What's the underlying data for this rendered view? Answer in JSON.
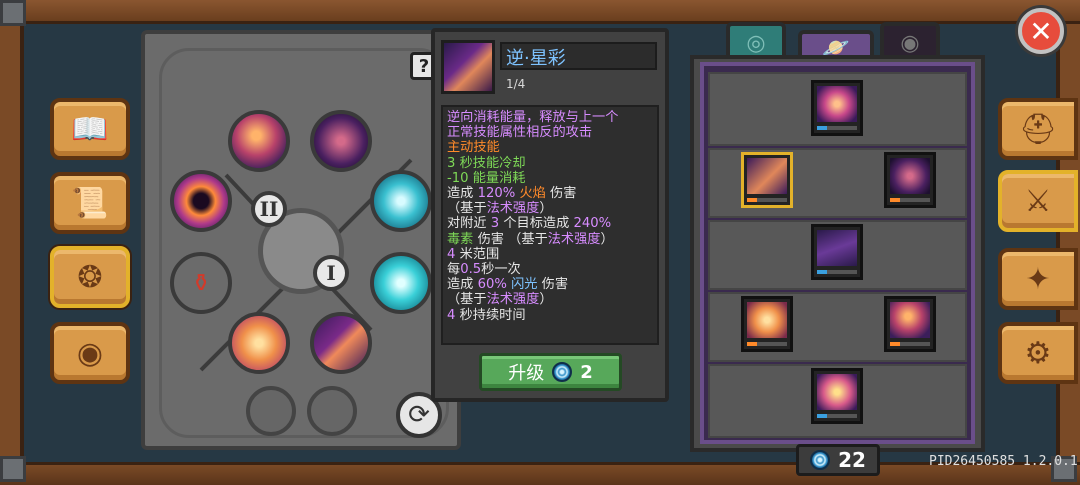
{
  "skill": {
    "name": "逆·星彩",
    "level": "1/4",
    "description": [
      [
        {
          "t": "逆向消耗能量，释放与上一个",
          "c": "p"
        }
      ],
      [
        {
          "t": "正常技能属性相反的攻击",
          "c": "p"
        }
      ],
      [
        {
          "t": "主动技能",
          "c": "o"
        }
      ],
      [
        {
          "t": "3 秒技能冷却",
          "c": "g"
        }
      ],
      [
        {
          "t": "-10 能量消耗",
          "c": "g"
        }
      ],
      [
        {
          "t": "造成 ",
          "c": "w"
        },
        {
          "t": "120%",
          "c": "p"
        },
        {
          "t": " 火焰",
          "c": "o"
        },
        {
          "t": " 伤害",
          "c": "w"
        }
      ],
      [
        {
          "t": "（基于",
          "c": "w"
        },
        {
          "t": "法术强度",
          "c": "p"
        },
        {
          "t": "）",
          "c": "w"
        }
      ],
      [
        {
          "t": "对附近 ",
          "c": "w"
        },
        {
          "t": "3",
          "c": "p"
        },
        {
          "t": " 个目标造成 ",
          "c": "w"
        },
        {
          "t": "240%",
          "c": "p"
        }
      ],
      [
        {
          "t": "毒素",
          "c": "g"
        },
        {
          "t": " 伤害 （基于",
          "c": "w"
        },
        {
          "t": "法术强度",
          "c": "p"
        },
        {
          "t": "）",
          "c": "w"
        }
      ],
      [
        {
          "t": "4",
          "c": "p"
        },
        {
          "t": " 米范围",
          "c": "w"
        }
      ],
      [
        {
          "t": "每",
          "c": "w"
        },
        {
          "t": "0.5",
          "c": "p"
        },
        {
          "t": "秒一次",
          "c": "w"
        }
      ],
      [
        {
          "t": "造成 ",
          "c": "w"
        },
        {
          "t": "60%",
          "c": "p"
        },
        {
          "t": " 闪光",
          "c": "b"
        },
        {
          "t": " 伤害",
          "c": "w"
        }
      ],
      [
        {
          "t": "（基于",
          "c": "w"
        },
        {
          "t": "法术强度",
          "c": "p"
        },
        {
          "t": "）",
          "c": "w"
        }
      ],
      [
        {
          "t": "4",
          "c": "p"
        },
        {
          "t": " 秒持续时间",
          "c": "w"
        }
      ]
    ]
  },
  "upgrade": {
    "label": "升级",
    "cost": "2"
  },
  "wheel": {
    "slot_two": "II",
    "slot_one": "I",
    "help": "?"
  },
  "gems": "22",
  "version": "PID26450585 1.2.0.1",
  "colors": {
    "fire": "#ff8a2a",
    "poison": "#7ed957",
    "light": "#7ec3ff",
    "magic": "#d78cff"
  }
}
